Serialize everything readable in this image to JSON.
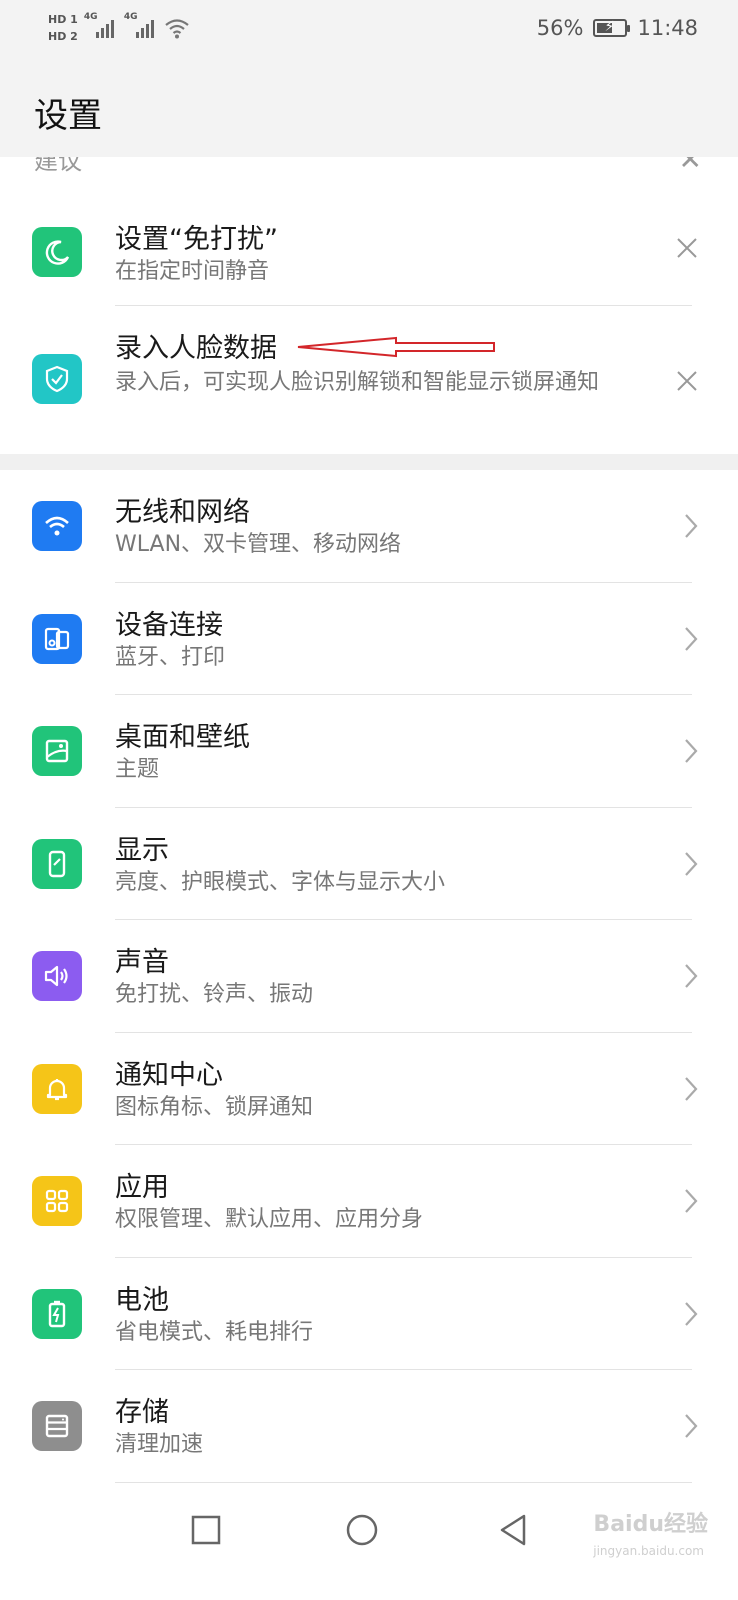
{
  "status_bar": {
    "hd1": "HD 1",
    "hd2": "HD 2",
    "net1": "4G",
    "net2": "4G",
    "battery_percent": "56%",
    "battery_level": 0.56,
    "time": "11:48"
  },
  "header": {
    "title": "设置"
  },
  "suggestions": {
    "label": "建议",
    "items": [
      {
        "title": "设置“免打扰”",
        "subtitle": "在指定时间静音",
        "icon": "moon-icon",
        "color": "#21c47a"
      },
      {
        "title": "录入人脸数据",
        "subtitle": "录入后，可实现人脸识别解锁和智能显示锁屏通知",
        "icon": "shield-check-icon",
        "color": "#22c6c6"
      }
    ]
  },
  "settings": [
    {
      "title": "无线和网络",
      "subtitle": "WLAN、双卡管理、移动网络",
      "icon": "wifi-icon",
      "color": "#1f7bf2"
    },
    {
      "title": "设备连接",
      "subtitle": "蓝牙、打印",
      "icon": "device-connect-icon",
      "color": "#1f7bf2"
    },
    {
      "title": "桌面和壁纸",
      "subtitle": "主题",
      "icon": "wallpaper-icon",
      "color": "#21c47a"
    },
    {
      "title": "显示",
      "subtitle": "亮度、护眼模式、字体与显示大小",
      "icon": "display-icon",
      "color": "#21c47a"
    },
    {
      "title": "声音",
      "subtitle": "免打扰、铃声、振动",
      "icon": "speaker-icon",
      "color": "#8c5cf0"
    },
    {
      "title": "通知中心",
      "subtitle": "图标角标、锁屏通知",
      "icon": "bell-icon",
      "color": "#f5c518"
    },
    {
      "title": "应用",
      "subtitle": "权限管理、默认应用、应用分身",
      "icon": "apps-grid-icon",
      "color": "#f5c518"
    },
    {
      "title": "电池",
      "subtitle": "省电模式、耗电排行",
      "icon": "battery-icon",
      "color": "#21c47a"
    },
    {
      "title": "存储",
      "subtitle": "清理加速",
      "icon": "storage-icon",
      "color": "#8e8e8e"
    }
  ],
  "annotation": {
    "color": "#d3262a"
  },
  "watermark": {
    "brand": "Baidu经验",
    "url": "jingyan.baidu.com"
  }
}
